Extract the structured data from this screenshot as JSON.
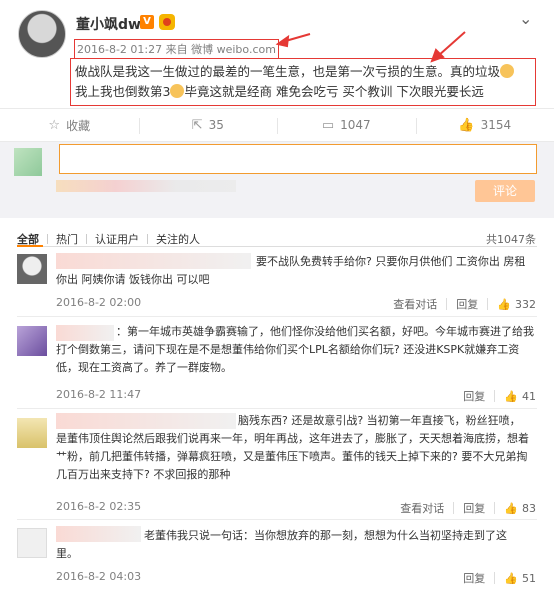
{
  "post": {
    "username": "董小飒dw",
    "v_badge": "V",
    "meta": "2016-8-2 01:27 来自 微博 weibo.com",
    "text_line1": "做战队是我这一生做过的最差的一笔生意，也是第一次亏损的生意。真的垃圾",
    "text_line2a": "我上我也倒数第3",
    "text_line2b": "毕竟这就是经商 难免会吃亏 买个教训 下次眼光要长远"
  },
  "actions": {
    "fav": "收藏",
    "repost": "35",
    "comment": "1047",
    "like": "3154"
  },
  "compose": {
    "send_label": "评论",
    "placeholder": ""
  },
  "filters": {
    "all": "全部",
    "hot": "热门",
    "verified": "认证用户",
    "following": "关注的人",
    "total": "共1047条"
  },
  "comments": [
    {
      "text_l1": "要不战队免费转手给你? 只要你月供他们 工资你出 房租",
      "text_l2": "你出 阿姨你请 饭钱你出 可以吧",
      "time": "2016-8-2 02:00",
      "view": "查看对话",
      "reply": "回复",
      "likes": "332"
    },
    {
      "text_l1": "：第一年城市英雄争霸赛输了，他们怪你没给他们买名额，好吧。今年城市赛进了给我",
      "text_l2": "打个倒数第三，请问下现在是不是想董伟给你们买个LPL名额给你们玩? 还没进KSPK就嫌弃工资",
      "text_l3": "低，现在工资高了。养了一群废物。",
      "time": "2016-8-2 11:47",
      "reply": "回复",
      "likes": "41"
    },
    {
      "text_l1": "脑残东西? 还是故意引战? 当初第一年直接飞，粉丝狂喷，",
      "text_l2": "是董伟顶住舆论然后跟我们说再来一年，明年再战，这年进去了，膨胀了，天天想着海底捞，想着",
      "text_l3": "艹粉，前几把董伟转播，弹幕疯狂喷，又是董伟压下喷声。董伟的钱天上掉下来的? 要不大兄弟掏",
      "text_l4": "几百万出来支持下? 不求回报的那种",
      "time": "2016-8-2 02:35",
      "view": "查看对话",
      "reply": "回复",
      "likes": "83"
    },
    {
      "text_l1": "老董伟我只说一句话：当你想放弃的那一刻，想想为什么当初坚持走到了这",
      "text_l2": "里。",
      "time": "2016-8-2 04:03",
      "reply": "回复",
      "likes": "51"
    }
  ],
  "colors": {
    "accent": "#ff8200",
    "highlight": "#e53935"
  }
}
